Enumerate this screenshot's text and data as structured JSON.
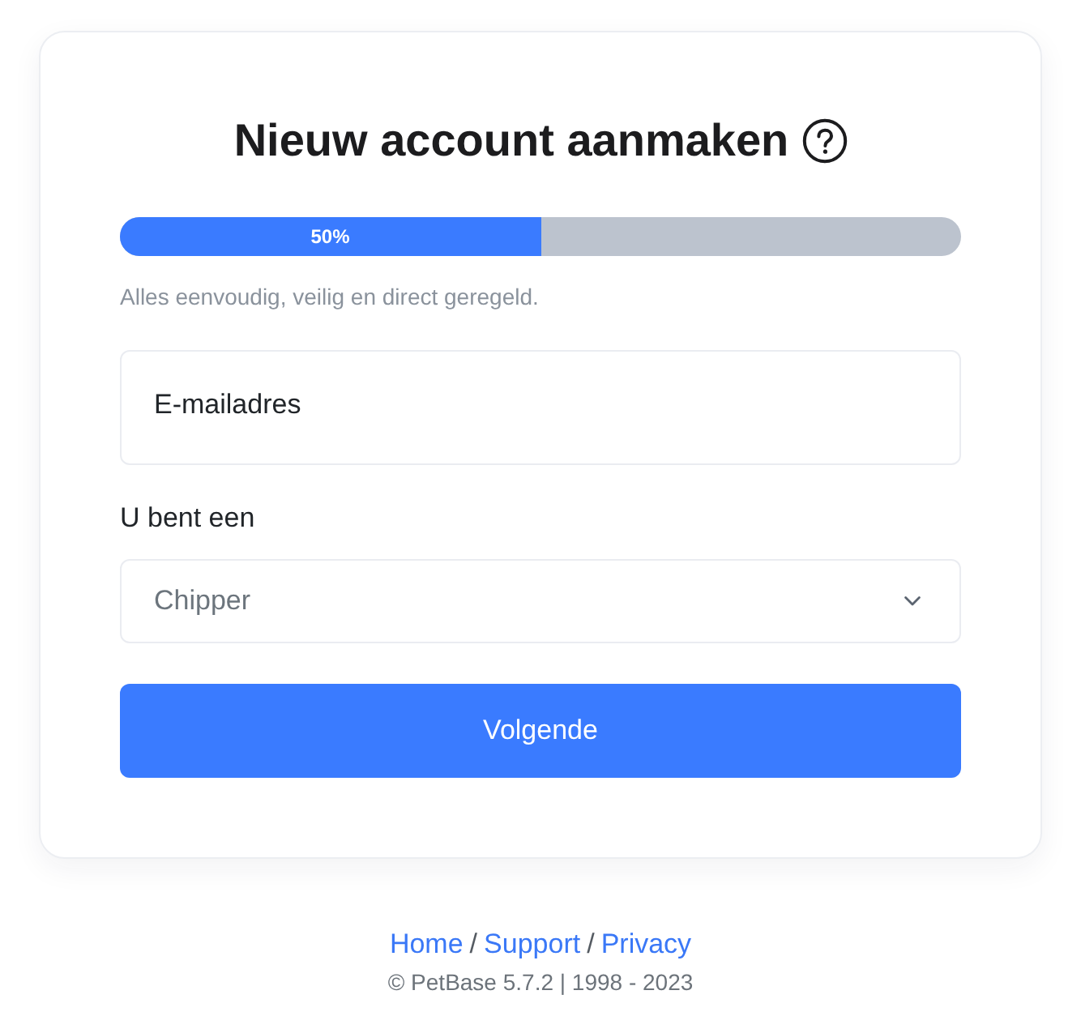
{
  "card": {
    "title": "Nieuw account aanmaken",
    "progress": {
      "level": 0.5,
      "reading": "50%"
    },
    "helper_text": "Alles eenvoudig, veilig en direct geregeld.",
    "email_field": {
      "placeholder": "E-mailadres"
    },
    "role_label": "U bent een",
    "role_select": {
      "value": "Chipper"
    },
    "submit_button": "Volgende"
  },
  "footer": {
    "nav": [
      {
        "kind": "link",
        "text": "Home"
      },
      {
        "kind": "separator",
        "text": "/"
      },
      {
        "kind": "link",
        "text": "Support"
      },
      {
        "kind": "separator",
        "text": "/"
      },
      {
        "kind": "link",
        "text": "Privacy"
      }
    ],
    "copyright": "© PetBase 5.7.2 | 1998 - 2023"
  }
}
